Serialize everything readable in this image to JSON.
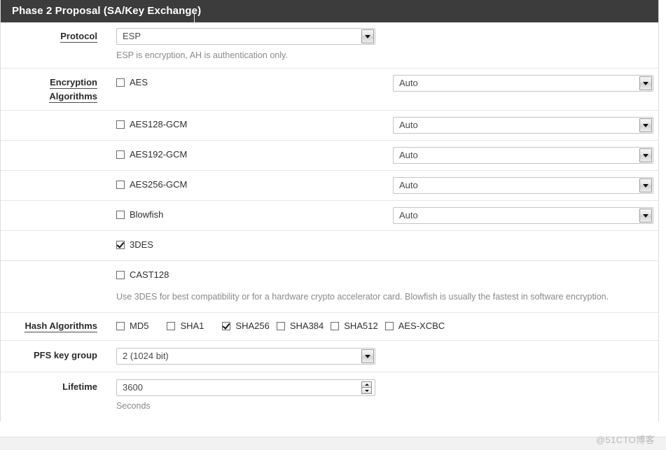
{
  "panel": {
    "title": "Phase 2 Proposal (SA/Key Exchange)"
  },
  "protocol": {
    "label": "Protocol",
    "value": "ESP",
    "help": "ESP is encryption, AH is authentication only."
  },
  "encryption": {
    "label_line1": "Encryption",
    "label_line2": "Algorithms",
    "rows": [
      {
        "name": "AES",
        "checked": false,
        "keylen": "Auto",
        "has_keylen": true
      },
      {
        "name": "AES128-GCM",
        "checked": false,
        "keylen": "Auto",
        "has_keylen": true
      },
      {
        "name": "AES192-GCM",
        "checked": false,
        "keylen": "Auto",
        "has_keylen": true
      },
      {
        "name": "AES256-GCM",
        "checked": false,
        "keylen": "Auto",
        "has_keylen": true
      },
      {
        "name": "Blowfish",
        "checked": false,
        "keylen": "Auto",
        "has_keylen": true
      },
      {
        "name": "3DES",
        "checked": true,
        "keylen": "",
        "has_keylen": false
      },
      {
        "name": "CAST128",
        "checked": false,
        "keylen": "",
        "has_keylen": false
      }
    ],
    "help": "Use 3DES for best compatibility or for a hardware crypto accelerator card. Blowfish is usually the fastest in software encryption."
  },
  "hash": {
    "label": "Hash Algorithms",
    "items": [
      {
        "name": "MD5",
        "checked": false
      },
      {
        "name": "SHA1",
        "checked": false
      },
      {
        "name": "SHA256",
        "checked": true
      },
      {
        "name": "SHA384",
        "checked": false
      },
      {
        "name": "SHA512",
        "checked": false
      },
      {
        "name": "AES-XCBC",
        "checked": false
      }
    ]
  },
  "pfs": {
    "label": "PFS key group",
    "value": "2 (1024 bit)"
  },
  "lifetime": {
    "label": "Lifetime",
    "value": "3600",
    "help": "Seconds"
  },
  "watermark": "@51CTO博客",
  "colors": {
    "header_bg": "#3c3c3c",
    "header_text": "#ffffff",
    "panel_bg": "#ffffff",
    "divider": "#e6e6e6",
    "help_text": "#8a8a8a"
  }
}
